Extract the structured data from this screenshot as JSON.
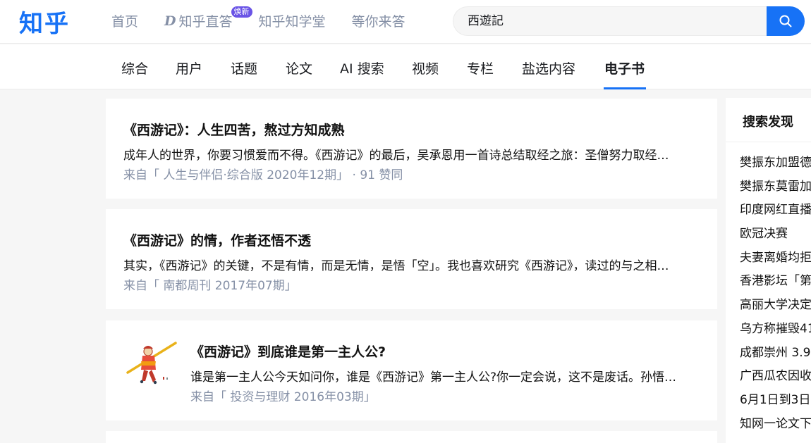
{
  "header": {
    "logo": "知乎",
    "nav": [
      {
        "label": "首页"
      },
      {
        "label": "知乎直答",
        "badge": "焕新"
      },
      {
        "label": "知乎知学堂"
      },
      {
        "label": "等你来答"
      }
    ],
    "search": {
      "value": "西遊記"
    }
  },
  "tabs": {
    "items": [
      "综合",
      "用户",
      "话题",
      "论文",
      "AI 搜索",
      "视频",
      "专栏",
      "盐选内容",
      "电子书"
    ],
    "active": "电子书"
  },
  "results": [
    {
      "title": "《西游记》：人生四苦，熬过方知成熟",
      "excerpt": "成年人的世界，你要习惯爱而不得。《西游记》的最后，吴承恩用一首诗总结取经之旅：圣僧努力取经编…",
      "meta": "来自「 人生与伴侣·综合版 2020年12期」 · 91 赞同"
    },
    {
      "title": "《西游记》的情，作者还悟不透",
      "excerpt": "其实，《西游记》的关键，不是有情，而是无情，是悟「空」。我也喜欢研究《西游记》，读过的与之相关…",
      "meta": "来自「 南都周刊 2017年07期」"
    },
    {
      "title": "《西游记》到底谁是第一主人公?",
      "excerpt": "谁是第一主人公今天如问你，谁是《西游记》第一主人公?你一定会说，这不是废话。孙悟空…",
      "meta": "来自「 投资与理财 2016年03期」",
      "thumb": "monkey-king-illustration"
    }
  ],
  "sidebar": {
    "title": "搜索发现",
    "items": [
      "樊振东加盟德",
      "樊振东莫雷加",
      "印度网红直播",
      "欧冠决赛",
      "夫妻离婚均拒",
      "香港影坛「第",
      "高丽大学决定",
      "乌方称摧毁41",
      "成都崇州 3.9",
      "广西瓜农因收",
      "6月1日到3日",
      "知网一论文下"
    ]
  },
  "colors": {
    "brand": "#1772f6",
    "muted": "#8590a6",
    "badge": "#6a54e6"
  }
}
